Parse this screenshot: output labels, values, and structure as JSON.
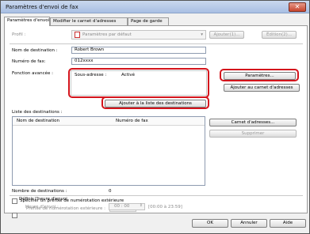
{
  "window": {
    "title": "Paramètres d'envoi de fax",
    "close": "✕"
  },
  "tabs": [
    "Paramètres d'envoi",
    "Modifier le carnet d'adresses",
    "Page de garde"
  ],
  "profile": {
    "label": "Profil :",
    "value": "Paramètres par défaut",
    "add": "Ajouter(1)...",
    "edit": "Édition(2)..."
  },
  "dest_name": {
    "label": "Nom de destination :",
    "value": "Robert Brown"
  },
  "fax_number": {
    "label": "Numéro de fax:",
    "value": "012xxxx"
  },
  "advanced": {
    "label": "Fonction avancée :",
    "sub_label": "Sous-adresse :",
    "sub_value": "Activé",
    "params_btn": "Paramètres...",
    "add_book_btn": "Ajouter au carnet d'adresses"
  },
  "add_to_list_btn": "Ajouter à la liste des destinations",
  "dest_list": {
    "label": "Liste des destinations :",
    "col_name": "Nom de destination",
    "col_fax": "Numéro de fax",
    "address_book_btn": "Carnet d'adresses...",
    "delete_btn": "Supprimer"
  },
  "dest_count": {
    "label": "Nombre de destinations :",
    "value": "0"
  },
  "prefix": {
    "label": "Spécifier un préfixe de numérotation extérieure",
    "sub_label": "Préfixe de numérotation extérieure :"
  },
  "schedule": {
    "label": "Définir l'heure d'envoi",
    "time_label": "Heure d'envoi :",
    "time_value": "00 : 00",
    "range": "[00:00 à 23:59]"
  },
  "footer": {
    "ok": "OK",
    "cancel": "Annuler",
    "help": "Aide"
  }
}
